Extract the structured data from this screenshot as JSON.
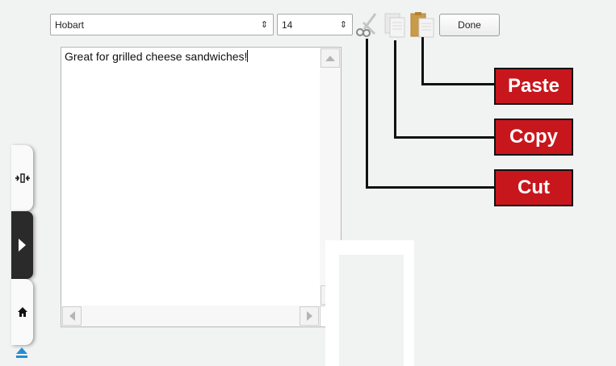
{
  "toolbar": {
    "font_name": "Hobart",
    "font_size": "14",
    "done_label": "Done",
    "icons": [
      "scissors-icon",
      "copy-icon",
      "paste-icon"
    ]
  },
  "editor": {
    "text": "Great for grilled cheese sandwiches!"
  },
  "callouts": {
    "paste": "Paste",
    "copy": "Copy",
    "cut": "Cut"
  },
  "colors": {
    "callout_red": "#c8161d",
    "accent_blue": "#1e8fd6"
  },
  "side_panel": {
    "icons": [
      "collapse-icon",
      "play-icon",
      "home-icon",
      "eject-icon"
    ]
  }
}
